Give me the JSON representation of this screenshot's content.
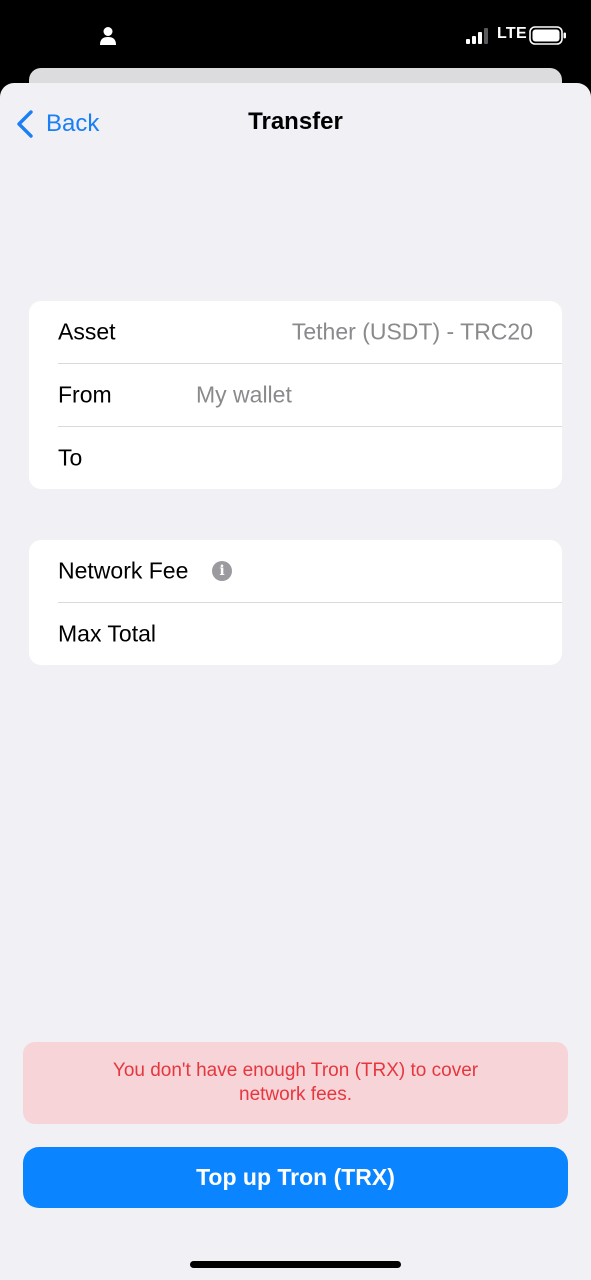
{
  "status_bar": {
    "network": "LTE",
    "icons": [
      "person-icon",
      "signal-icon",
      "battery-icon"
    ]
  },
  "nav": {
    "back_label": "Back",
    "title": "Transfer",
    "back_icon": "chevron-left-icon"
  },
  "details": {
    "asset_label": "Asset",
    "asset_value": "Tether (USDT) - TRC20",
    "from_label": "From",
    "from_value": "My wallet",
    "to_label": "To"
  },
  "fees": {
    "network_fee_label": "Network Fee",
    "info_icon": "info-icon",
    "info_glyph": "i",
    "max_total_label": "Max Total"
  },
  "warning": {
    "text": "You don't have enough Tron (TRX) to cover network fees."
  },
  "actions": {
    "topup_label": "Top up Tron (TRX)"
  },
  "colors": {
    "accent": "#0a84ff",
    "link": "#1a7ef5",
    "warning_text": "#e6373f",
    "warning_bg": "#f6d4d8",
    "background": "#f0f0f5"
  }
}
